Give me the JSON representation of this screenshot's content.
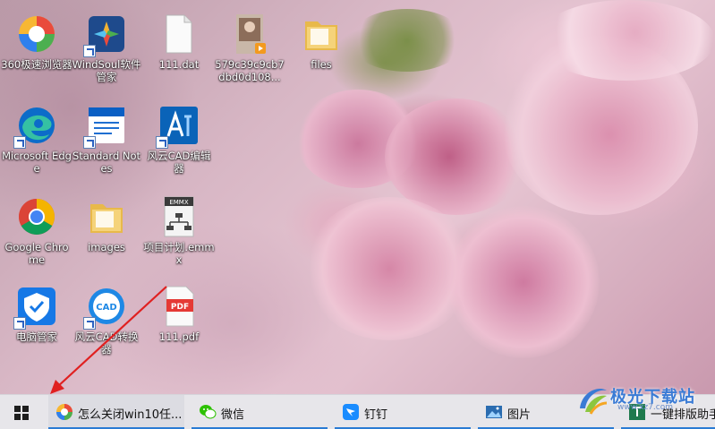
{
  "desktop": {
    "icons": [
      {
        "label": "360极速浏览器",
        "icon": "360-browser-icon"
      },
      {
        "label": "WindSoul软件管家",
        "icon": "windsoul-icon"
      },
      {
        "label": "111.dat",
        "icon": "blank-file-icon"
      },
      {
        "label": "579c39c9cb7dbd0d108...",
        "icon": "video-file-icon"
      },
      {
        "label": "files",
        "icon": "folder-icon"
      },
      {
        "label": "Microsoft Edge",
        "icon": "edge-icon"
      },
      {
        "label": "Standard Notes",
        "icon": "standard-notes-icon"
      },
      {
        "label": "风云CAD编辑器",
        "icon": "fengyun-cad-editor-icon"
      },
      {
        "label": "Google Chrome",
        "icon": "chrome-icon"
      },
      {
        "label": "images",
        "icon": "folder-icon"
      },
      {
        "label": "项目计划.emmx",
        "icon": "emmx-file-icon"
      },
      {
        "label": "电脑管家",
        "icon": "pc-manager-icon"
      },
      {
        "label": "风云CAD转换器",
        "icon": "fengyun-cad-converter-icon"
      },
      {
        "label": "111.pdf",
        "icon": "pdf-file-icon"
      }
    ],
    "emmx_badge": "EMMX",
    "pdf_badge": "PDF",
    "cad_badge": "CAD"
  },
  "taskbar": {
    "items": [
      {
        "label": "怎么关闭win10任...",
        "icon": "360-browser-icon"
      },
      {
        "label": "微信",
        "icon": "wechat-icon"
      },
      {
        "label": "钉钉",
        "icon": "dingtalk-icon"
      },
      {
        "label": "图片",
        "icon": "photos-icon"
      },
      {
        "label": "一键排版助手",
        "icon": "typesetting-icon"
      }
    ]
  },
  "watermark": {
    "text": "极光下载站",
    "sub": "www.xz7.com"
  },
  "colors": {
    "taskbar_bg": "#e7e6ea",
    "active_underline": "#2a7bd4",
    "annotation_arrow": "#e02020"
  }
}
